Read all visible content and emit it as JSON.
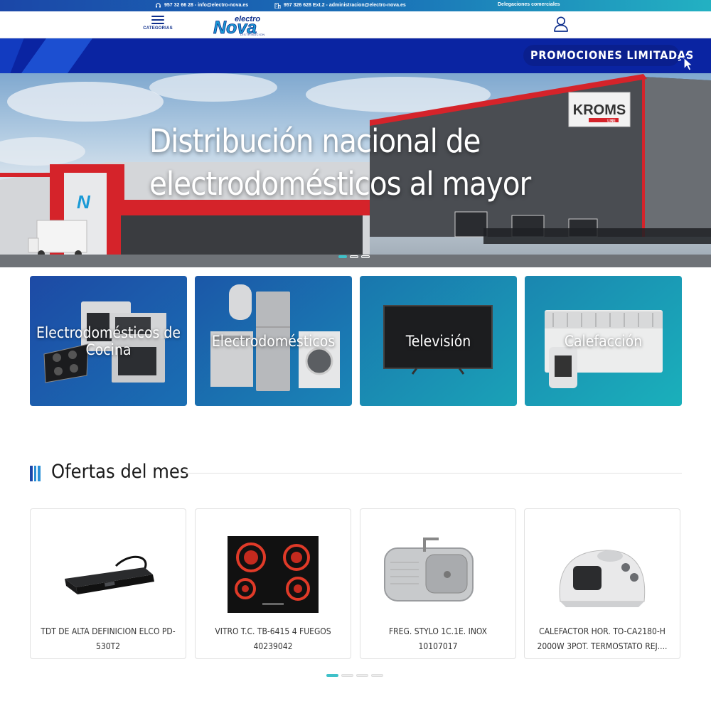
{
  "topbar": {
    "phone_text": "957 32 66 28 - info@electro-nova.es",
    "phone_icon": "headset-icon",
    "admin_text": "957 326 628 Ext.2 - administracion@electro-nova.es",
    "admin_icon": "building-icon",
    "delegations_link": "Delegaciones comerciales"
  },
  "header": {
    "categories_label": "CATEGORIAS",
    "logo_text_top": "electro",
    "logo_text_main": "Nova",
    "logo_text_sub": "DISTRIBUCION",
    "user_icon": "user-icon"
  },
  "promo": {
    "button_label": "PROMOCIONES LIMITADAS",
    "cursor_icon": "click-cursor-icon"
  },
  "hero": {
    "title": "Distribución nacional de electrodomésticos al mayor",
    "sign_brand": "KROMS",
    "sign_sub": "LINE",
    "slides": 3,
    "active_slide": 1
  },
  "categories": [
    {
      "label": "Electrodomésticos de Cocina"
    },
    {
      "label": "Electrodomésticos"
    },
    {
      "label": "Televisión"
    },
    {
      "label": "Calefacción"
    }
  ],
  "offers": {
    "title": "Ofertas del mes",
    "products": [
      {
        "name": "TDT DE ALTA DEFINICION ELCO PD-530T2"
      },
      {
        "name": "VITRO T.C. TB-6415 4 FUEGOS 40239042"
      },
      {
        "name": "FREG. STYLO 1C.1E. INOX 10107017"
      },
      {
        "name": "CALEFACTOR HOR. TO-CA2180-H 2000W 3POT. TERMOSTATO REJ...."
      }
    ],
    "pages": 4,
    "active_page": 1
  },
  "colors": {
    "brand_blue": "#0a24a2",
    "accent_teal": "#3fc1c9",
    "navy": "#0d2e8c"
  }
}
